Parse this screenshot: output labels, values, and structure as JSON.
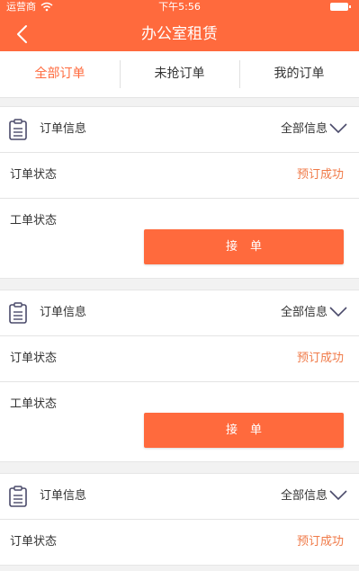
{
  "status_bar": {
    "carrier": "运营商",
    "time": "下午5:56"
  },
  "nav": {
    "title": "办公室租赁"
  },
  "tabs": [
    {
      "label": "全部订单",
      "active": true
    },
    {
      "label": "未抢订单",
      "active": false
    },
    {
      "label": "我的订单",
      "active": false
    }
  ],
  "orders": [
    {
      "info_label": "订单信息",
      "all_info_label": "全部信息",
      "order_status_label": "订单状态",
      "order_status_value": "预订成功",
      "work_status_label": "工单状态",
      "accept_label": "接单"
    },
    {
      "info_label": "订单信息",
      "all_info_label": "全部信息",
      "order_status_label": "订单状态",
      "order_status_value": "预订成功",
      "work_status_label": "工单状态",
      "accept_label": "接单"
    },
    {
      "info_label": "订单信息",
      "all_info_label": "全部信息",
      "order_status_label": "订单状态",
      "order_status_value": "预订成功"
    }
  ],
  "colors": {
    "accent": "#ff6a3d",
    "status": "#f07a48",
    "background": "#f2f2f2"
  }
}
